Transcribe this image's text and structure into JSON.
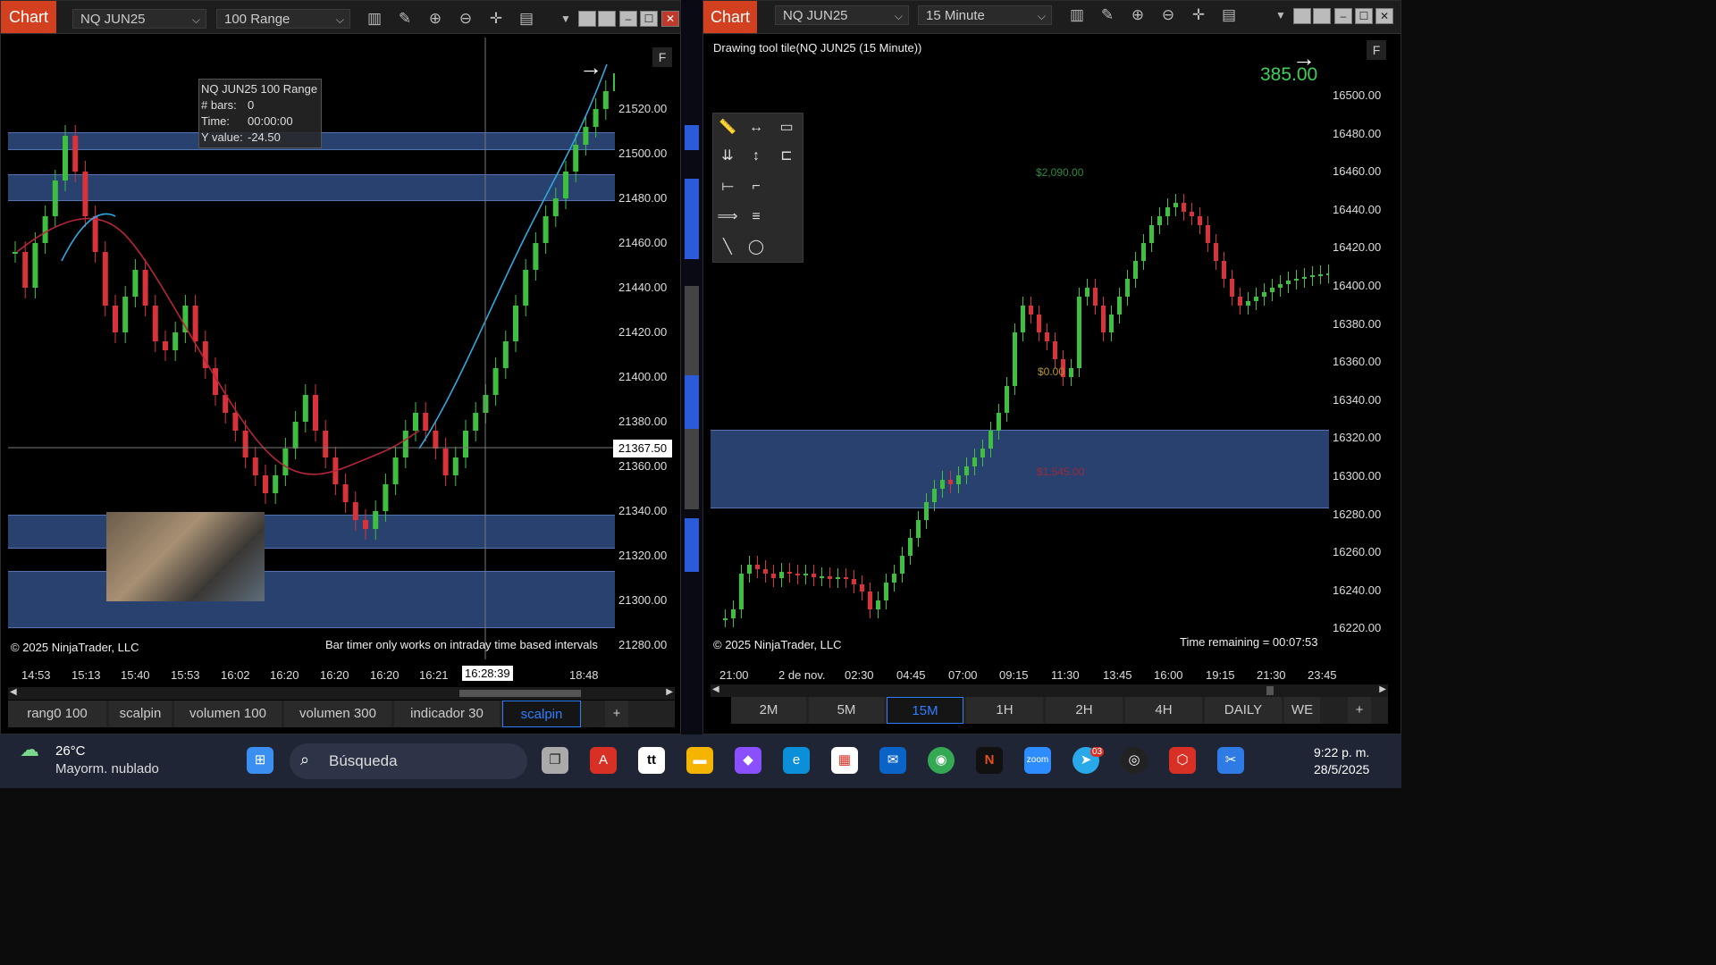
{
  "left_chart": {
    "tab_label": "Chart",
    "instrument": "NQ JUN25",
    "interval": "100 Range",
    "f_button": "F",
    "info_box": {
      "title": "NQ JUN25 100 Range",
      "bars_label": "# bars:",
      "bars_value": "0",
      "time_label": "Time:",
      "time_value": "00:00:00",
      "y_label": "Y value:",
      "y_value": "-24.50"
    },
    "price_marker": "21367.50",
    "copyright": "© 2025 NinjaTrader, LLC",
    "bar_timer_note": "Bar timer only works on intraday time based intervals",
    "y_ticks": [
      "21520.00",
      "21500.00",
      "21480.00",
      "21460.00",
      "21440.00",
      "21420.00",
      "21400.00",
      "21380.00",
      "21360.00",
      "21340.00",
      "21320.00",
      "21300.00",
      "21280.00"
    ],
    "x_ticks": [
      "14:53",
      "15:13",
      "15:40",
      "15:53",
      "16:02",
      "16:20",
      "16:20",
      "16:20",
      "16:21",
      "16:28:39",
      "18:48"
    ],
    "tabs": [
      "rang0 100",
      "scalpin",
      "volumen 100",
      "volumen 300",
      "indicador 30",
      "scalpin"
    ],
    "active_tab_index": 5,
    "add_tab": "+"
  },
  "right_chart": {
    "tab_label": "Chart",
    "instrument": "NQ JUN25",
    "interval": "15 Minute",
    "f_button": "F",
    "header_text": "Drawing tool tile(NQ JUN25 (15 Minute))",
    "pnl_value": "385.00",
    "pnl_color": "#3ecf5a",
    "annotation_top": "$2,090.00",
    "annotation_mid": "$0.00",
    "annotation_low": "$1,545.00",
    "time_remaining": "Time remaining = 00:07:53",
    "copyright": "© 2025 NinjaTrader, LLC",
    "y_ticks": [
      "16500.00",
      "16480.00",
      "16460.00",
      "16440.00",
      "16420.00",
      "16400.00",
      "16380.00",
      "16360.00",
      "16340.00",
      "16320.00",
      "16300.00",
      "16280.00",
      "16260.00",
      "16240.00",
      "16220.00"
    ],
    "x_ticks": [
      "21:00",
      "2 de nov.",
      "02:30",
      "04:45",
      "07:00",
      "09:15",
      "11:30",
      "13:45",
      "16:00",
      "19:15",
      "21:30",
      "23:45"
    ],
    "interval_tabs": [
      "2M",
      "5M",
      "15M",
      "1H",
      "2H",
      "4H",
      "DAILY",
      "WE"
    ],
    "active_interval_index": 2,
    "add_tab": "+"
  },
  "taskbar": {
    "weather_temp": "26°C",
    "weather_desc": "Mayorm. nublado",
    "search_label": "Búsqueda",
    "time": "9:22 p. m.",
    "date": "28/5/2025",
    "badge_count": "03"
  },
  "colors": {
    "chart_tab": "#d2401f",
    "zone": "#2c4778",
    "bull": "#3fbf3f",
    "bear": "#d8333a",
    "ma_red": "#b5263a",
    "ma_blue": "#2fa9e0"
  }
}
